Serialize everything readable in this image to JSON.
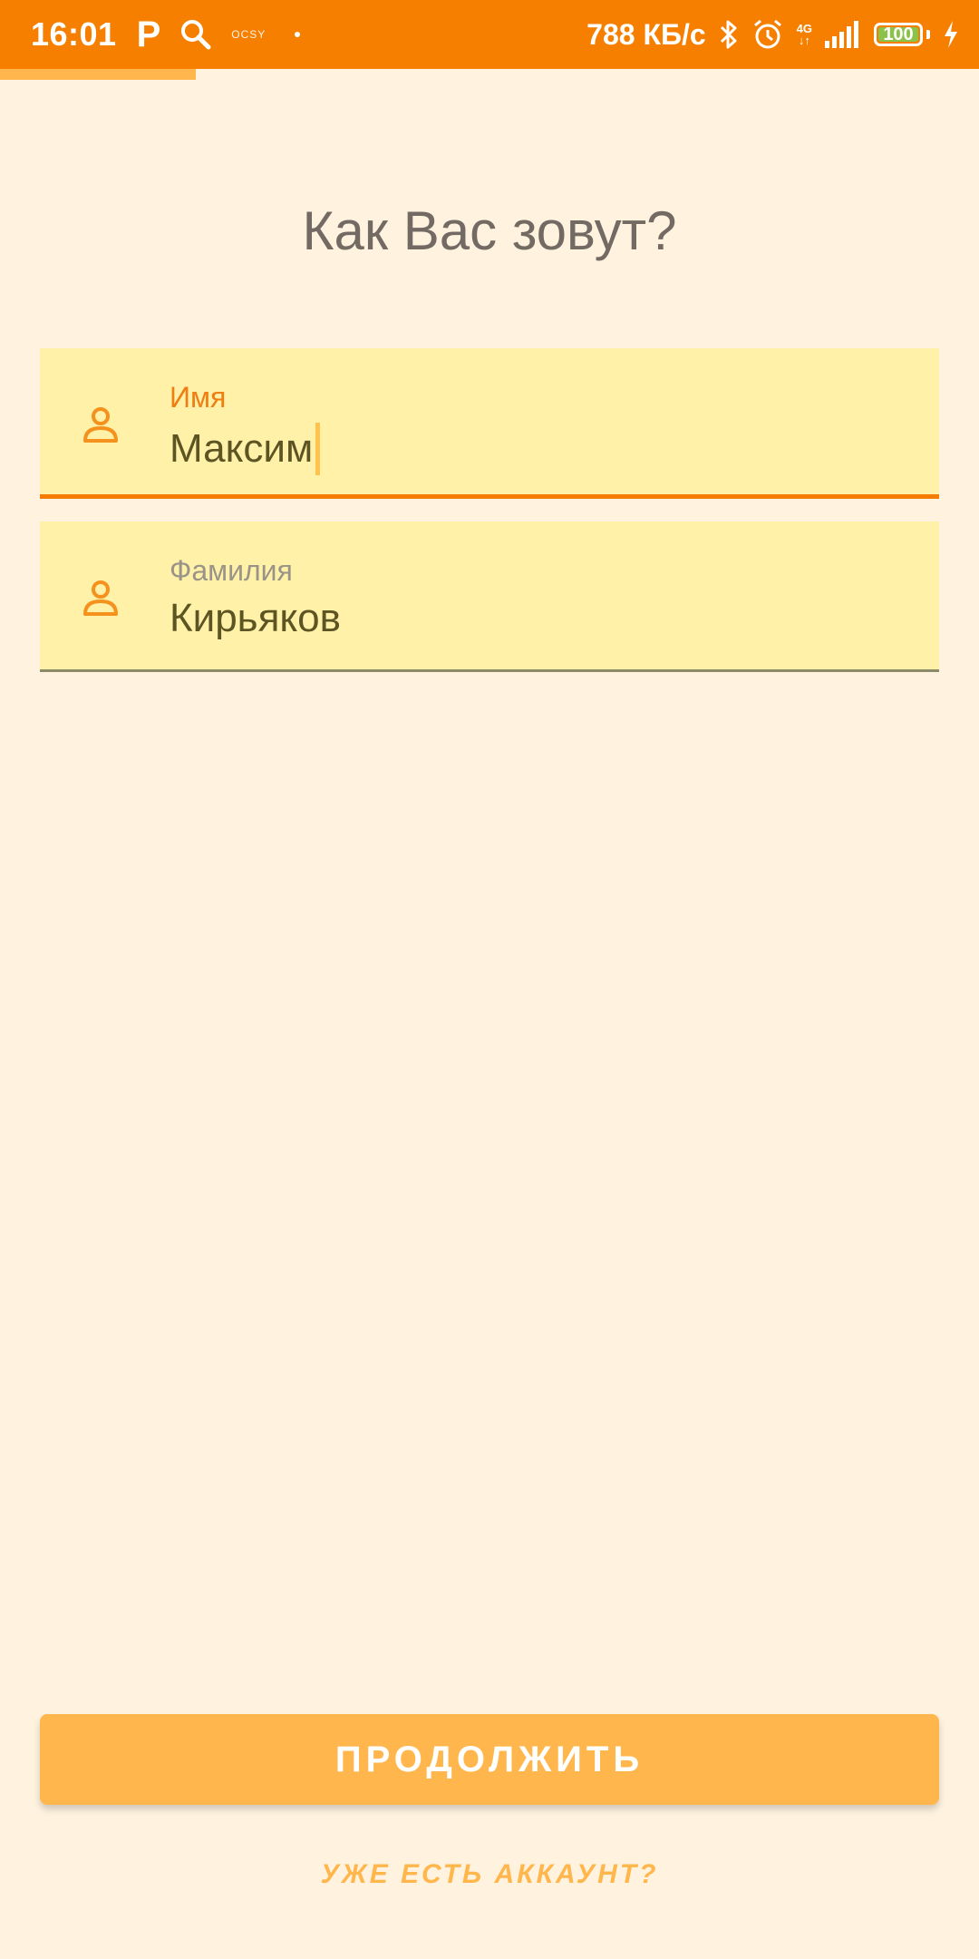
{
  "status_bar": {
    "time": "16:01",
    "left_icons": [
      "p-app-icon",
      "search-icon",
      "ocsy-icon",
      "dot-icon"
    ],
    "ocsy_text": "OCSY",
    "speed": "788 КБ/с",
    "network": "4G",
    "battery": "100",
    "right_icons": [
      "bluetooth-icon",
      "alarm-icon",
      "signal-icon",
      "battery-icon",
      "charging-icon"
    ]
  },
  "progress": {
    "value_percent": 20,
    "color": "#ffb74d"
  },
  "header": {
    "title": "Как Вас зовут?"
  },
  "form": {
    "first_name": {
      "label": "Имя",
      "value": "Максим",
      "icon": "person-icon",
      "focused": true
    },
    "last_name": {
      "label": "Фамилия",
      "value": "Кирьяков",
      "icon": "person-icon",
      "focused": false
    }
  },
  "actions": {
    "continue_label": "ПРОДОЛЖИТЬ",
    "have_account_label": "УЖЕ ЕСТЬ АККАУНТ?"
  },
  "colors": {
    "status_bar": "#f77f00",
    "background": "#fff3e0",
    "field_bg": "#fff1a8",
    "accent": "#f57c00",
    "button": "#ffb74d"
  }
}
